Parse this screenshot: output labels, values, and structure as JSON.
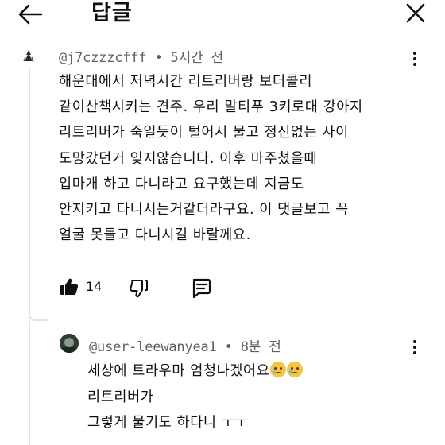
{
  "header": {
    "title": "답글",
    "back_icon": "arrow-left-icon",
    "close_icon": "close-icon"
  },
  "comment": {
    "author": "@j7czzzcfff",
    "separator": "•",
    "time": "5시간 전",
    "lines": [
      "해운대에서 저녁시간 리트리버랑 보더콜리",
      "같이산책시키는 견주. 우리 말티푸 3키로대 강아지",
      "리트리버가 죽일듯이 털어서 물고 정신없는 사이",
      "도망갔던거 잊지않습니다. 이후 마주쳤을때",
      "입마개 하고 다니라고 요구했는데 지금도",
      "안지키고 다니시는거같더라구요. 이 댓글보고 꼭",
      "얼굴 못들고 다니시길 바랄께요."
    ],
    "like_count": "14"
  },
  "reply": {
    "author": "@user-leewanyea1",
    "separator": "•",
    "time": "8분 전",
    "lines": [
      "세상에 트라우마 엄청나겠어요",
      "리트리버가",
      "그렇게 물기도 하다니 ㅜㅜ"
    ],
    "emoji": "crying-face-emoji"
  },
  "colors": {
    "text": "#0f0f0f",
    "meta": "#606060",
    "thread": "#e3e3e3"
  }
}
